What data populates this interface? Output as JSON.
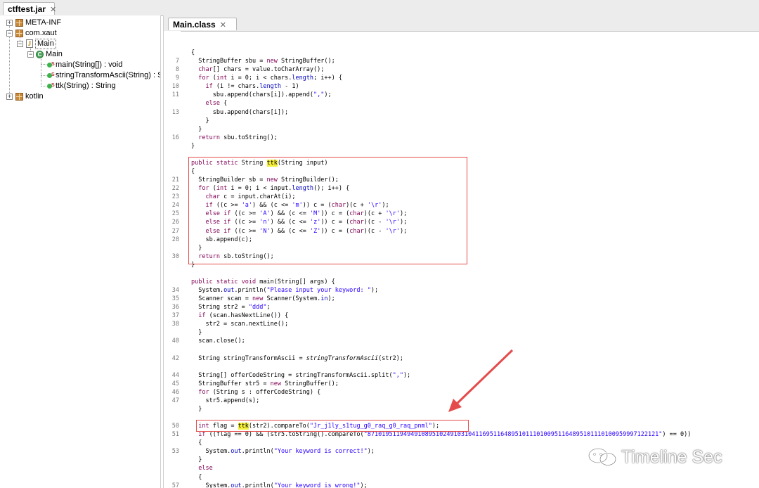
{
  "outer_tab": {
    "title": "ctftest.jar",
    "close": "✕"
  },
  "tree": {
    "meta_inf": "META-INF",
    "com_xaut": "com.xaut",
    "main_file": "Main",
    "main_class": "Main",
    "methods": [
      "main(String[]) : void",
      "stringTransformAscii(String) : Strin",
      "ttk(String) : String"
    ],
    "kotlin": "kotlin"
  },
  "editor_tab": {
    "title": "Main.class",
    "close": "✕"
  },
  "code": {
    "lines": [
      {
        "n": "",
        "t": "{"
      },
      {
        "n": "7",
        "t": "  StringBuffer sbu = new StringBuffer();"
      },
      {
        "n": "8",
        "t": "  char[] chars = value.toCharArray();"
      },
      {
        "n": "9",
        "t": "  for (int i = 0; i < chars.length; i++) {"
      },
      {
        "n": "10",
        "t": "    if (i != chars.length - 1)"
      },
      {
        "n": "11",
        "t": "      sbu.append(chars[i]).append(\",\");"
      },
      {
        "n": "",
        "t": "    else {"
      },
      {
        "n": "13",
        "t": "      sbu.append(chars[i]);"
      },
      {
        "n": "",
        "t": "    }"
      },
      {
        "n": "",
        "t": "  }"
      },
      {
        "n": "16",
        "t": "  return sbu.toString();"
      },
      {
        "n": "",
        "t": "}"
      },
      {
        "n": "",
        "t": ""
      },
      {
        "n": "",
        "t": "public static String ttk(String input)"
      },
      {
        "n": "",
        "t": "{"
      },
      {
        "n": "21",
        "t": "  StringBuilder sb = new StringBuilder();"
      },
      {
        "n": "22",
        "t": "  for (int i = 0; i < input.length(); i++) {"
      },
      {
        "n": "23",
        "t": "    char c = input.charAt(i);"
      },
      {
        "n": "24",
        "t": "    if ((c >= 'a') && (c <= 'm')) c = (char)(c + '\\r');"
      },
      {
        "n": "25",
        "t": "    else if ((c >= 'A') && (c <= 'M')) c = (char)(c + '\\r');"
      },
      {
        "n": "26",
        "t": "    else if ((c >= 'n') && (c <= 'z')) c = (char)(c - '\\r');"
      },
      {
        "n": "27",
        "t": "    else if ((c >= 'N') && (c <= 'Z')) c = (char)(c - '\\r');"
      },
      {
        "n": "28",
        "t": "    sb.append(c);"
      },
      {
        "n": "",
        "t": "  }"
      },
      {
        "n": "30",
        "t": "  return sb.toString();"
      },
      {
        "n": "",
        "t": "}"
      },
      {
        "n": "",
        "t": ""
      },
      {
        "n": "",
        "t": "public static void main(String[] args) {"
      },
      {
        "n": "34",
        "t": "  System.out.println(\"Please input your keyword: \");"
      },
      {
        "n": "35",
        "t": "  Scanner scan = new Scanner(System.in);"
      },
      {
        "n": "36",
        "t": "  String str2 = \"ddd\";"
      },
      {
        "n": "37",
        "t": "  if (scan.hasNextLine()) {"
      },
      {
        "n": "38",
        "t": "    str2 = scan.nextLine();"
      },
      {
        "n": "",
        "t": "  }"
      },
      {
        "n": "40",
        "t": "  scan.close();"
      },
      {
        "n": "",
        "t": ""
      },
      {
        "n": "42",
        "t": "  String stringTransformAscii = stringTransformAscii(str2);"
      },
      {
        "n": "",
        "t": ""
      },
      {
        "n": "44",
        "t": "  String[] offerCodeString = stringTransformAscii.split(\",\");"
      },
      {
        "n": "45",
        "t": "  StringBuffer str5 = new StringBuffer();"
      },
      {
        "n": "46",
        "t": "  for (String s : offerCodeString) {"
      },
      {
        "n": "47",
        "t": "    str5.append(s);"
      },
      {
        "n": "",
        "t": "  }"
      },
      {
        "n": "",
        "t": ""
      },
      {
        "n": "50",
        "t": "  int flag = ttk(str2).compareTo(\"Jr_j1ly_s1tug_g0_raq_g0_raq_pnml\");"
      },
      {
        "n": "51",
        "t": "  if ((flag == 0) && (str5.toString().compareTo(\"871019511949491089510249103104116951164895101110100951164895101110100959997122121\") == 0))"
      },
      {
        "n": "",
        "t": "  {"
      },
      {
        "n": "53",
        "t": "    System.out.println(\"Your keyword is correct!\");"
      },
      {
        "n": "",
        "t": "  }"
      },
      {
        "n": "",
        "t": "  else"
      },
      {
        "n": "",
        "t": "  {"
      },
      {
        "n": "57",
        "t": "    System.out.println(\"Your keyword is wrong!\");"
      },
      {
        "n": "",
        "t": "  }"
      }
    ]
  },
  "watermark": {
    "text": "Timeline Sec",
    "icon": "wechat-icon"
  },
  "colors": {
    "keyword": "#7f0055",
    "string": "#2a00ff",
    "field": "#0000c0",
    "highlight": "#f4ef3a",
    "annotation": "#e54b4b"
  }
}
